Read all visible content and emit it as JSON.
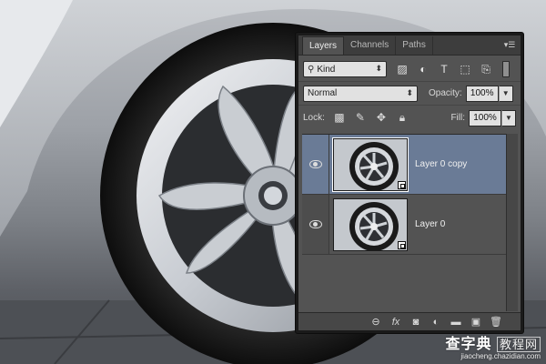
{
  "panel": {
    "tabs": [
      "Layers",
      "Channels",
      "Paths"
    ],
    "menu_icon": "panel-menu-icon",
    "filter": {
      "kind_label": "Kind",
      "icons": [
        "pixel-filter-icon",
        "adjustment-filter-icon",
        "type-filter-icon",
        "shape-filter-icon",
        "smart-object-filter-icon"
      ]
    },
    "blend_mode": "Normal",
    "opacity_label": "Opacity:",
    "opacity_value": "100%",
    "lock_label": "Lock:",
    "lock_icons": [
      "lock-transparent-icon",
      "lock-image-icon",
      "lock-position-icon",
      "lock-all-icon"
    ],
    "fill_label": "Fill:",
    "fill_value": "100%",
    "layers": [
      {
        "name": "Layer 0 copy",
        "selected": true,
        "visible": true,
        "smart_object": true
      },
      {
        "name": "Layer 0",
        "selected": false,
        "visible": true,
        "smart_object": true
      }
    ],
    "bottom_icons": [
      "link-layers-icon",
      "fx-icon",
      "mask-icon",
      "adjustment-layer-icon",
      "group-folder-icon",
      "new-layer-icon",
      "trash-icon"
    ],
    "bottom_glyphs": [
      "⊖",
      "fx",
      "◙",
      "◐",
      "▬",
      "▣",
      "🗑"
    ]
  },
  "watermark": {
    "brand_cn": "查字典",
    "brand_cn2": "教程网",
    "url": "jiaocheng.chazidian.com"
  },
  "colors": {
    "panel_bg": "#535353",
    "selected_layer": "#6a7b96",
    "tabbar": "#3d3d3d"
  }
}
